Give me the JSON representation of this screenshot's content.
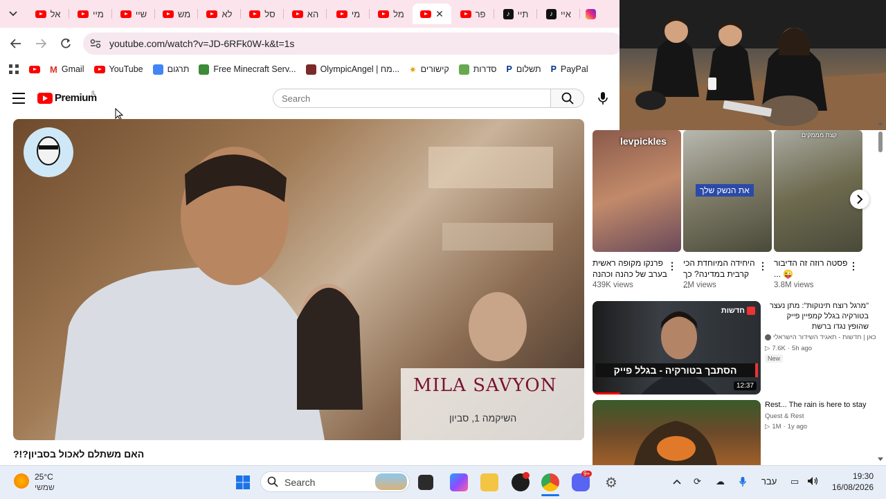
{
  "browser": {
    "tabs": [
      {
        "label": "אל",
        "icon": "youtube-icon"
      },
      {
        "label": "מיי",
        "icon": "youtube-icon"
      },
      {
        "label": "שיי",
        "icon": "youtube-icon"
      },
      {
        "label": "מש",
        "icon": "youtube-icon"
      },
      {
        "label": "לא",
        "icon": "youtube-icon"
      },
      {
        "label": "סל",
        "icon": "youtube-icon"
      },
      {
        "label": "הא",
        "icon": "youtube-icon"
      },
      {
        "label": "מי",
        "icon": "youtube-icon"
      },
      {
        "label": "מל",
        "icon": "youtube-icon"
      },
      {
        "label": "",
        "icon": "youtube-icon",
        "active": true,
        "close": "✕"
      },
      {
        "label": "פר",
        "icon": "youtube-icon"
      },
      {
        "label": "תיי",
        "icon": "tiktok-icon"
      },
      {
        "label": "איי",
        "icon": "tiktok-icon"
      },
      {
        "label": "",
        "icon": "instagram-icon"
      }
    ],
    "url": "youtube.com/watch?v=JD-6RFk0W-k&t=1s",
    "bookmarks": [
      {
        "label": "",
        "icon": "youtube-icon"
      },
      {
        "label": "Gmail",
        "icon": "gmail-icon"
      },
      {
        "label": "YouTube",
        "icon": "youtube-icon"
      },
      {
        "label": "תרגום",
        "icon": "translate-icon"
      },
      {
        "label": "Free Minecraft Serv...",
        "icon": "minecraft-icon"
      },
      {
        "label": "OlympicAngel | מח...",
        "icon": "olympic-icon"
      },
      {
        "label": "קישורים",
        "icon": "star-icon"
      },
      {
        "label": "סדרות",
        "icon": "series-icon"
      },
      {
        "label": "תשלום",
        "icon": "paypal-icon"
      },
      {
        "label": "PayPal",
        "icon": "paypal-icon"
      }
    ]
  },
  "youtube": {
    "brand": "Premium",
    "country": "IL",
    "search_placeholder": "Search",
    "video_title": "האם משתלם לאכול בסביון?!?",
    "video_overlay": {
      "logo_text": "MILA SAVYON",
      "sub_text": "השיקמה 1, סביון"
    },
    "shorts": [
      {
        "title": "פרנקו מקופה ראשית בערב של כהנה וכהנה",
        "views": "439K views",
        "overlay": "levpickles"
      },
      {
        "title": "היחידה המיוחדת הכי קרבית במדינה? כך ...",
        "views": "2M views",
        "overlay": "את הנשק שלך"
      },
      {
        "title": "פסטה רוזה זה הדיבור 😜 ...",
        "views": "3.8M views",
        "overlay": "קצת מממקים"
      }
    ],
    "recommended": [
      {
        "title": "\"מרגל רוצח תינוקות\": מתן נעצר בטורקיה בגלל קמפיין פייק שהופץ נגדו ברשת",
        "channel": "כאן | חדשות - תאגיד השידור הישראלי",
        "views": "7.6K",
        "age": "5h ago",
        "badge": "New",
        "duration": "12:37",
        "thumb_caption": "הסתבך בטורקיה - בגלל פייק",
        "thumb_tag": "חדשות"
      },
      {
        "title": "Rest... The rain is here to stay",
        "channel": "Quest & Rest",
        "views": "1M",
        "age": "1y ago",
        "badge": "",
        "duration": "",
        "thumb_caption": "",
        "thumb_tag": ""
      }
    ]
  },
  "taskbar": {
    "weather_temp": "25°C",
    "weather_label": "שמשי",
    "search_label": "Search",
    "lang": "עבר",
    "time": "19:30",
    "date": "16/08/2026",
    "notification_count": "9+"
  },
  "colors": {
    "tab_strip": "#fbe4ec",
    "youtube_red": "#ff0000",
    "taskbar": "#e8eef7"
  }
}
